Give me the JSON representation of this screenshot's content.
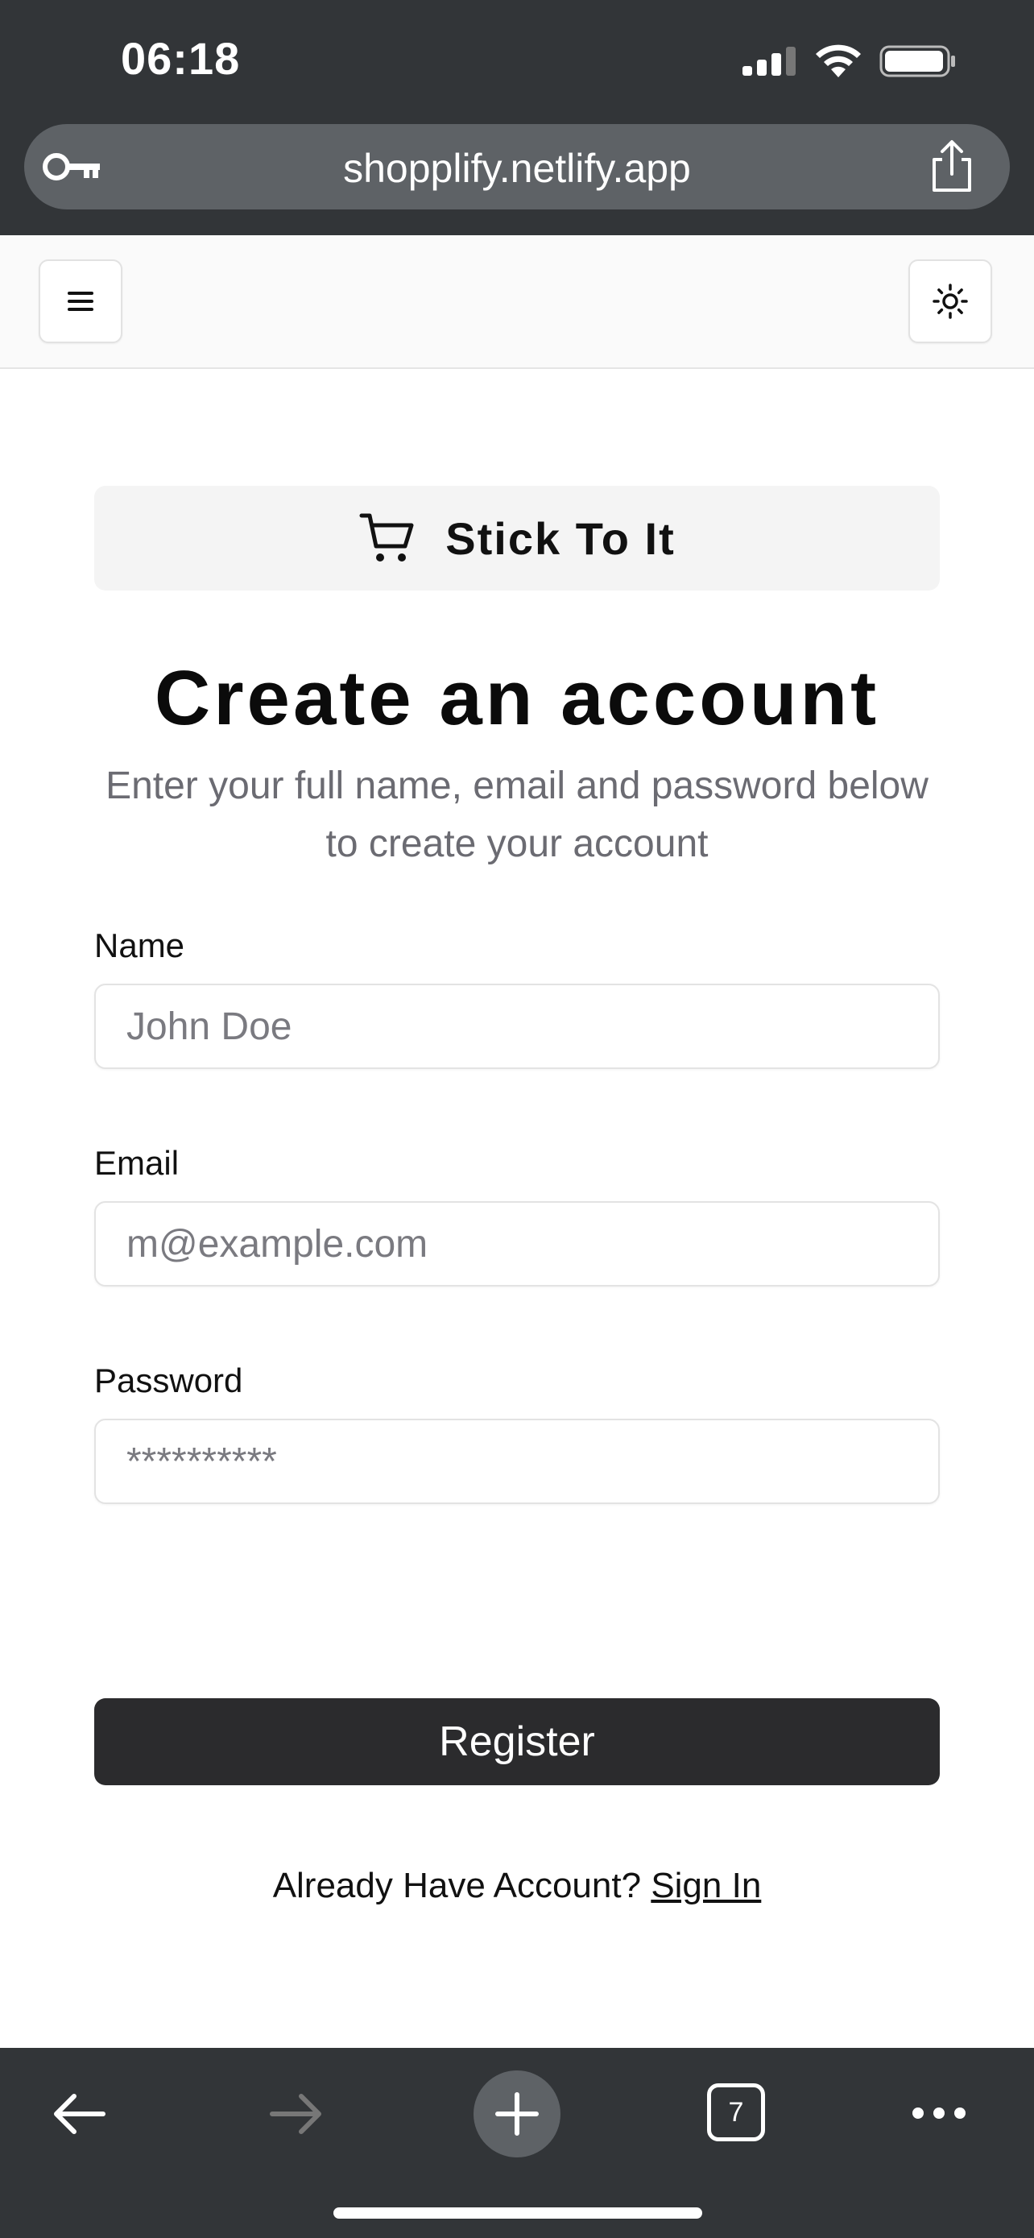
{
  "status_bar": {
    "time": "06:18"
  },
  "browser": {
    "url": "shopplify.netlify.app"
  },
  "header": {
    "menu_icon": "hamburger-menu-icon",
    "theme_icon": "sun-icon"
  },
  "brand": {
    "icon": "shopping-cart-icon",
    "name": "Stick To It"
  },
  "page": {
    "title": "Create an account",
    "subtitle": "Enter your full name, email and password below to create your account"
  },
  "form": {
    "name": {
      "label": "Name",
      "placeholder": "John Doe",
      "value": ""
    },
    "email": {
      "label": "Email",
      "placeholder": "m@example.com",
      "value": ""
    },
    "password": {
      "label": "Password",
      "placeholder": "**********",
      "value": ""
    },
    "submit_label": "Register"
  },
  "signin": {
    "prompt": "Already Have Account?",
    "link": "Sign In"
  },
  "toolbar": {
    "tab_count": "7"
  },
  "colors": {
    "browser_chrome": "#323538",
    "button_dark": "#2b2b2d",
    "muted_text": "#6b6b72"
  }
}
